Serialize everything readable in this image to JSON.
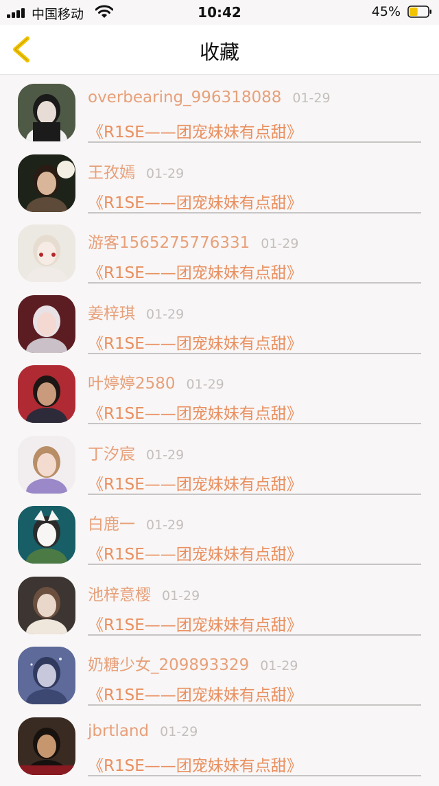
{
  "status_bar": {
    "carrier": "中国移动",
    "time": "10:42",
    "battery_percent": "45%",
    "battery_level": 0.45
  },
  "header": {
    "title": "收藏",
    "back_icon": "chevron-left-icon"
  },
  "colors": {
    "accent": "#e98f5f",
    "name_color": "#e7a07a",
    "date_color": "#c4bfbd",
    "back_icon": "#f2c400",
    "battery_fill": "#f2c400"
  },
  "favorites": [
    {
      "user": "overbearing_996318088",
      "date": "01-29",
      "title": "《R1SE——团宠妹妹有点甜》"
    },
    {
      "user": "王孜嫣",
      "date": "01-29",
      "title": "《R1SE——团宠妹妹有点甜》"
    },
    {
      "user": "游客1565275776331",
      "date": "01-29",
      "title": "《R1SE——团宠妹妹有点甜》"
    },
    {
      "user": "姜梓琪",
      "date": "01-29",
      "title": "《R1SE——团宠妹妹有点甜》"
    },
    {
      "user": "叶婷婷2580",
      "date": "01-29",
      "title": "《R1SE——团宠妹妹有点甜》"
    },
    {
      "user": "丁汐宸",
      "date": "01-29",
      "title": "《R1SE——团宠妹妹有点甜》"
    },
    {
      "user": "白鹿一",
      "date": "01-29",
      "title": "《R1SE——团宠妹妹有点甜》"
    },
    {
      "user": "池梓意樱",
      "date": "01-29",
      "title": "《R1SE——团宠妹妹有点甜》"
    },
    {
      "user": "奶糖少女_209893329",
      "date": "01-29",
      "title": "《R1SE——团宠妹妹有点甜》"
    },
    {
      "user": "jbrtland",
      "date": "01-29",
      "title": "《R1SE——团宠妹妹有点甜》"
    }
  ]
}
